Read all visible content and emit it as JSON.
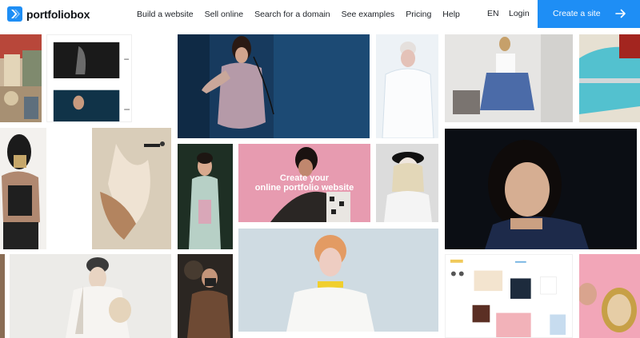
{
  "header": {
    "brand": "portfoliobox",
    "nav": [
      {
        "label": "Build a website"
      },
      {
        "label": "Sell online"
      },
      {
        "label": "Search for a domain"
      },
      {
        "label": "See examples"
      },
      {
        "label": "Pricing"
      },
      {
        "label": "Help"
      }
    ],
    "language": "EN",
    "login": "Login",
    "cta": "Create a site"
  },
  "hero": {
    "line1": "Create your",
    "line2": "online portfolio website"
  },
  "colors": {
    "accent": "#1e8ef5",
    "logo": "#1e8ef5",
    "hero_pink": "#e79bb0"
  }
}
